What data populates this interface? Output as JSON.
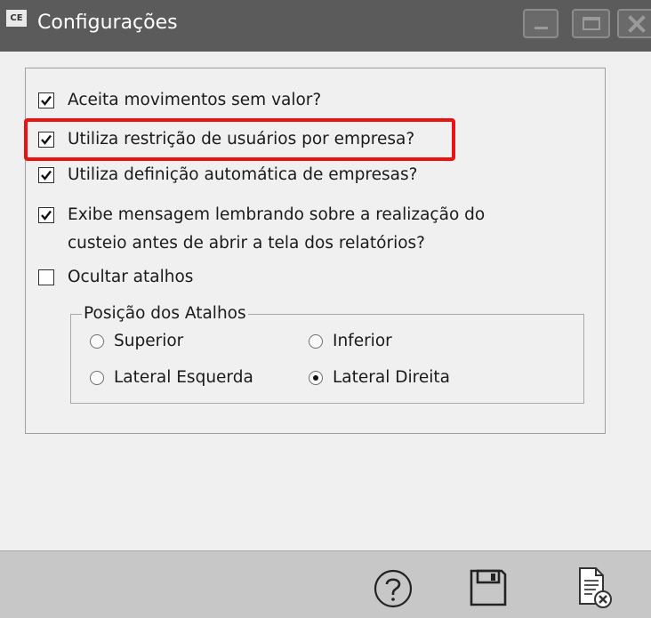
{
  "window": {
    "app_icon_text": "CE",
    "title": "Configurações",
    "icons": [
      "minimize-icon",
      "maximize-icon",
      "close-icon"
    ]
  },
  "options": [
    {
      "label": "Aceita movimentos sem valor?",
      "checked": true
    },
    {
      "label": "Utiliza restrição de usuários por empresa?",
      "checked": true,
      "highlighted": true
    },
    {
      "label": "Utiliza definição automática de empresas?",
      "checked": true
    },
    {
      "label_line1": "Exibe mensagem lembrando sobre a realização do",
      "label_line2": "custeio antes de abrir a tela dos relatórios?",
      "checked": true
    },
    {
      "label": "Ocultar atalhos",
      "checked": false
    }
  ],
  "shortcut_position": {
    "legend": "Posição dos Atalhos",
    "options": [
      {
        "label": "Superior",
        "selected": false
      },
      {
        "label": "Inferior",
        "selected": false
      },
      {
        "label": "Lateral Esquerda",
        "selected": false
      },
      {
        "label": "Lateral Direita",
        "selected": true
      }
    ]
  },
  "toolbar": {
    "icons": [
      "help-icon",
      "save-icon",
      "cancel-document-icon"
    ]
  },
  "colors": {
    "titlebar": "#5b5b5b",
    "highlight": "#ee1111",
    "footer": "#c7c7c7"
  }
}
